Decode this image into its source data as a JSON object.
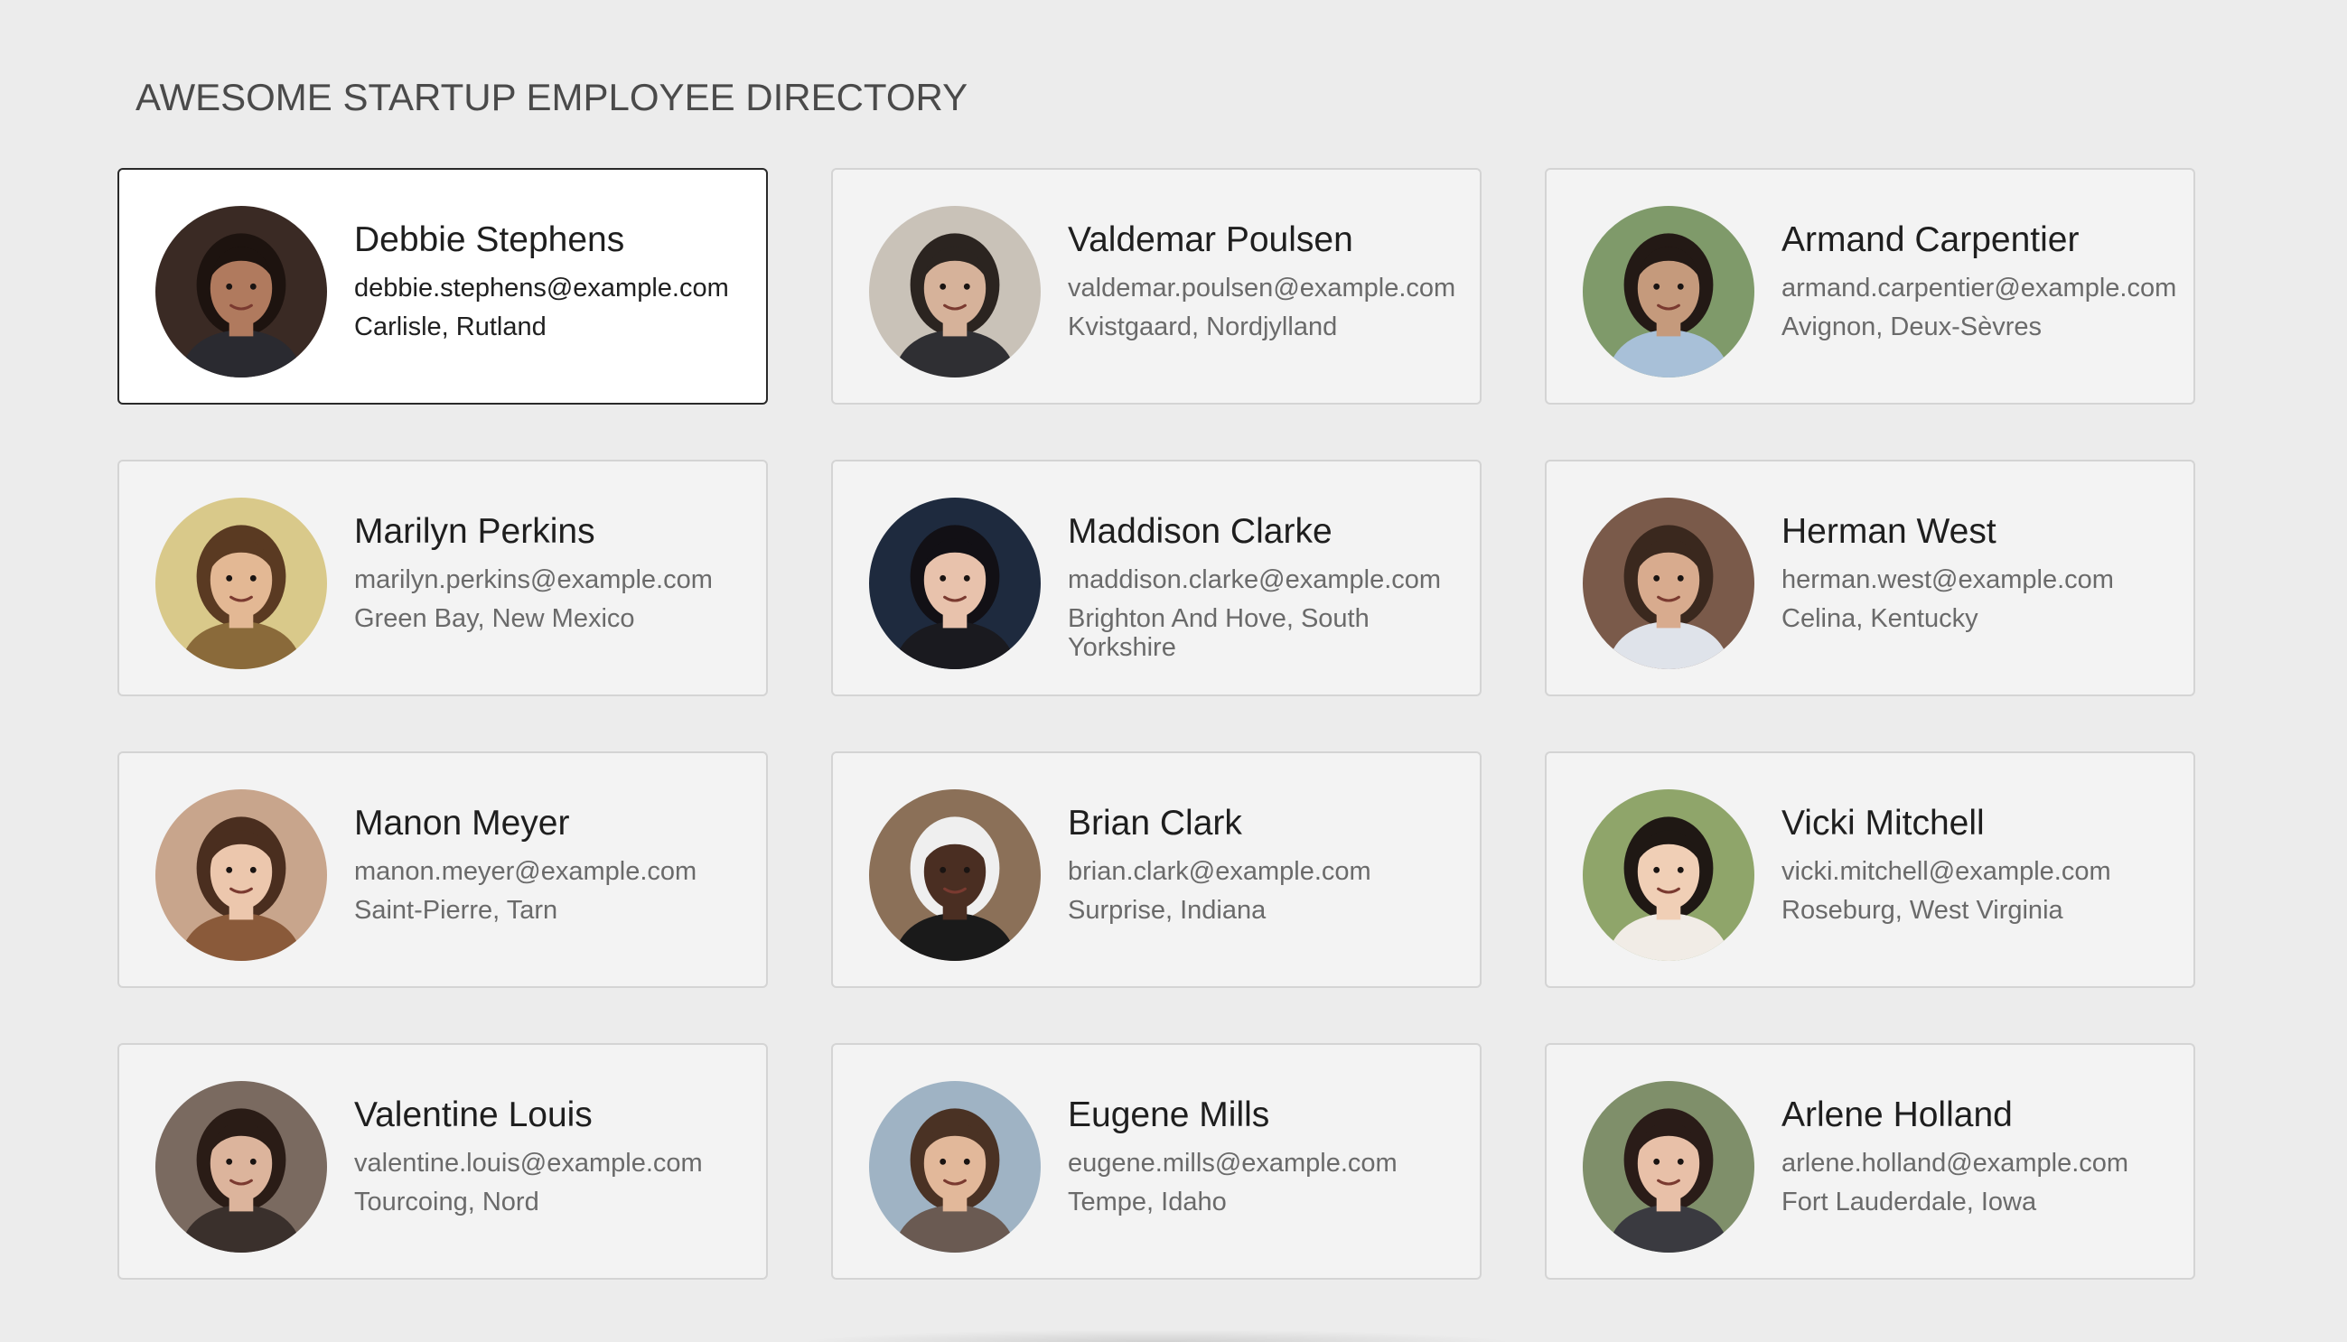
{
  "page": {
    "title": "AWESOME STARTUP EMPLOYEE DIRECTORY"
  },
  "employees": [
    {
      "name": "Debbie Stephens",
      "email": "debbie.stephens@example.com",
      "location": "Carlisle, Rutland",
      "selected": true,
      "avatar": {
        "bg": "#3a2a24",
        "skin": "#b07a5e",
        "hair": "#1d130f",
        "shirt": "#2a2a30"
      }
    },
    {
      "name": "Valdemar Poulsen",
      "email": "valdemar.poulsen@example.com",
      "location": "Kvistgaard, Nordjylland",
      "selected": false,
      "avatar": {
        "bg": "#c9c2b8",
        "skin": "#d6b29a",
        "hair": "#2b2420",
        "shirt": "#2f2f33"
      }
    },
    {
      "name": "Armand Carpentier",
      "email": "armand.carpentier@example.com",
      "location": "Avignon, Deux-Sèvres",
      "selected": false,
      "avatar": {
        "bg": "#7f9a6a",
        "skin": "#c59a7c",
        "hair": "#231915",
        "shirt": "#a8c0d8"
      }
    },
    {
      "name": "Marilyn Perkins",
      "email": "marilyn.perkins@example.com",
      "location": "Green Bay, New Mexico",
      "selected": false,
      "avatar": {
        "bg": "#d9c98a",
        "skin": "#e3b894",
        "hair": "#5a3a22",
        "shirt": "#8a6a3a"
      }
    },
    {
      "name": "Maddison Clarke",
      "email": "maddison.clarke@example.com",
      "location": "Brighton And Hove, South Yorkshire",
      "selected": false,
      "avatar": {
        "bg": "#1e2a3e",
        "skin": "#e8c2ac",
        "hair": "#121015",
        "shirt": "#1a1a1f"
      }
    },
    {
      "name": "Herman West",
      "email": "herman.west@example.com",
      "location": "Celina, Kentucky",
      "selected": false,
      "avatar": {
        "bg": "#7a5a4a",
        "skin": "#d8ab8e",
        "hair": "#3a281e",
        "shirt": "#dfe3ea"
      }
    },
    {
      "name": "Manon Meyer",
      "email": "manon.meyer@example.com",
      "location": "Saint-Pierre, Tarn",
      "selected": false,
      "avatar": {
        "bg": "#c8a58c",
        "skin": "#ecc7ad",
        "hair": "#4a2e1f",
        "shirt": "#8a5a3a"
      }
    },
    {
      "name": "Brian Clark",
      "email": "brian.clark@example.com",
      "location": "Surprise, Indiana",
      "selected": false,
      "avatar": {
        "bg": "#8b7058",
        "skin": "#4a2e22",
        "hair": "#efefef",
        "shirt": "#1a1a1a"
      }
    },
    {
      "name": "Vicki Mitchell",
      "email": "vicki.mitchell@example.com",
      "location": "Roseburg, West Virginia",
      "selected": false,
      "avatar": {
        "bg": "#8fa56a",
        "skin": "#f0cfb6",
        "hair": "#1f1814",
        "shirt": "#f1ece6"
      }
    },
    {
      "name": "Valentine Louis",
      "email": "valentine.louis@example.com",
      "location": "Tourcoing, Nord",
      "selected": false,
      "avatar": {
        "bg": "#7a6a60",
        "skin": "#dcb49c",
        "hair": "#2a1c16",
        "shirt": "#3a302c"
      }
    },
    {
      "name": "Eugene Mills",
      "email": "eugene.mills@example.com",
      "location": "Tempe, Idaho",
      "selected": false,
      "avatar": {
        "bg": "#9fb3c4",
        "skin": "#e2b89a",
        "hair": "#4a3224",
        "shirt": "#6a5a52"
      }
    },
    {
      "name": "Arlene Holland",
      "email": "arlene.holland@example.com",
      "location": "Fort Lauderdale, Iowa",
      "selected": false,
      "avatar": {
        "bg": "#7f8f6a",
        "skin": "#e8c0a8",
        "hair": "#2a1c18",
        "shirt": "#3a3a40"
      }
    }
  ]
}
